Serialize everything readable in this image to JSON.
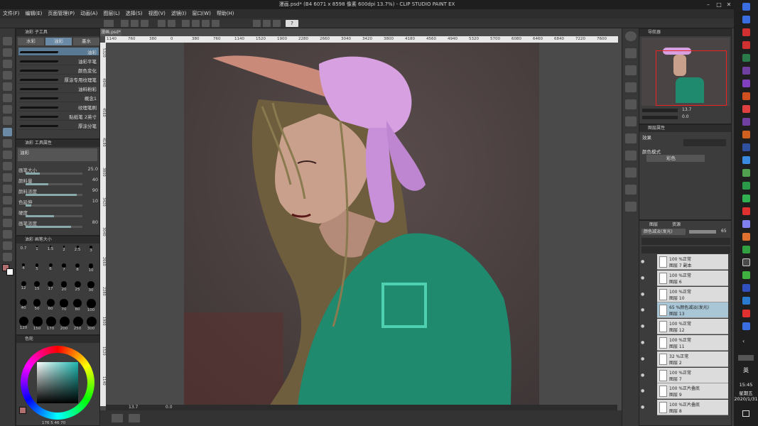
{
  "window": {
    "title": "漫画.psd* (B4 6071 x 8598 像素 600dpi 13.7%) - CLIP STUDIO PAINT EX"
  },
  "menu": [
    "文件(F)",
    "编辑(E)",
    "页面管理(P)",
    "动画(A)",
    "图层(L)",
    "选择(S)",
    "视图(V)",
    "滤镜(I)",
    "窗口(W)",
    "帮助(H)"
  ],
  "toolbar": {
    "help": "?"
  },
  "subtool_panel": {
    "title": "油彩 子工具",
    "tabs": [
      "水彩",
      "油彩",
      "墨水"
    ],
    "brushes": [
      "油彩",
      "油彩平笔",
      "颜色变化",
      "厚涂专用纹理笔",
      "油料粉彩",
      "概念1",
      "纹理笔刷",
      "贴纸笔 2英寸",
      "厚涂分笔"
    ]
  },
  "tool_property": {
    "title": "油彩 工具属性",
    "name": "油彩",
    "rows": [
      {
        "label": "画笔大小",
        "value": "25.0",
        "level": 0.25
      },
      {
        "label": "颜料量",
        "value": "40",
        "level": 0.4
      },
      {
        "label": "颜料浓度",
        "value": "90",
        "level": 0.9
      },
      {
        "label": "色延伸",
        "value": "10",
        "level": 0.1
      },
      {
        "label": "硬度",
        "value": "",
        "level": 0.5
      },
      {
        "label": "画笔浓度",
        "value": "80",
        "level": 0.8
      }
    ]
  },
  "brush_size_panel": {
    "title": "油彩 画笔大小",
    "sizes": [
      "0.7",
      "1",
      "1.5",
      "2",
      "2.5",
      "3",
      "4",
      "5",
      "6",
      "7",
      "8",
      "10",
      "12",
      "15",
      "17",
      "20",
      "25",
      "30",
      "40",
      "50",
      "60",
      "70",
      "80",
      "100",
      "120",
      "150",
      "170",
      "200",
      "250",
      "300"
    ]
  },
  "color_panel": {
    "title": "色轮",
    "readout": [
      "176",
      "5",
      "46",
      "70"
    ]
  },
  "canvas": {
    "tab": "漫画.psd*",
    "ruler_h": [
      "1140",
      "760",
      "380",
      "0",
      "380",
      "760",
      "1140",
      "1520",
      "1900",
      "2280",
      "2660",
      "3040",
      "3420",
      "3800",
      "4180",
      "4560",
      "4940",
      "5320",
      "5700",
      "6080",
      "6460",
      "6840",
      "7220",
      "7600"
    ],
    "ruler_v": [
      "5320",
      "4940",
      "4560",
      "4180",
      "3800",
      "3420",
      "3040",
      "2660",
      "2280",
      "1900",
      "1520",
      "1140"
    ],
    "zoom": "13.7",
    "rotation": "0.0"
  },
  "navigator": {
    "title": "导航器",
    "zoom": "13.7",
    "rotation": "0.0"
  },
  "layer_props": {
    "title": "图层属性",
    "effect_label": "效果",
    "mode_label": "颜色模式",
    "mode_value": "彩色"
  },
  "layers_panel": {
    "tabs": [
      "图层",
      "资源"
    ],
    "blend": "颜色减淡(发光)",
    "opacity": "65",
    "layers": [
      {
        "line1": "100 %正常",
        "line2": "图层 7 副本",
        "selected": false
      },
      {
        "line1": "100 %正常",
        "line2": "图层 6",
        "selected": false
      },
      {
        "line1": "100 %正常",
        "line2": "图层 10",
        "selected": false
      },
      {
        "line1": "65 %颜色减淡(发光)",
        "line2": "图层 13",
        "selected": true
      },
      {
        "line1": "100 %正常",
        "line2": "图层 12",
        "selected": false
      },
      {
        "line1": "100 %正常",
        "line2": "图层 11",
        "selected": false
      },
      {
        "line1": "32 %正常",
        "line2": "图层 2",
        "selected": false
      },
      {
        "line1": "100 %正常",
        "line2": "图层 7",
        "selected": false
      },
      {
        "line1": "100 %正片叠底",
        "line2": "图层 9",
        "selected": false
      },
      {
        "line1": "100 %正片叠底",
        "line2": "图层 8",
        "selected": false
      }
    ]
  },
  "taskbar": {
    "ime": "英",
    "time": "15:45",
    "day": "星期五",
    "date": "2020/1/31"
  },
  "colors": {
    "skin": "#c9a08c",
    "hat": "#d7a0e0",
    "hair": "#7a6a44",
    "jacket": "#1f8a6e",
    "bg": "#4a4444"
  }
}
